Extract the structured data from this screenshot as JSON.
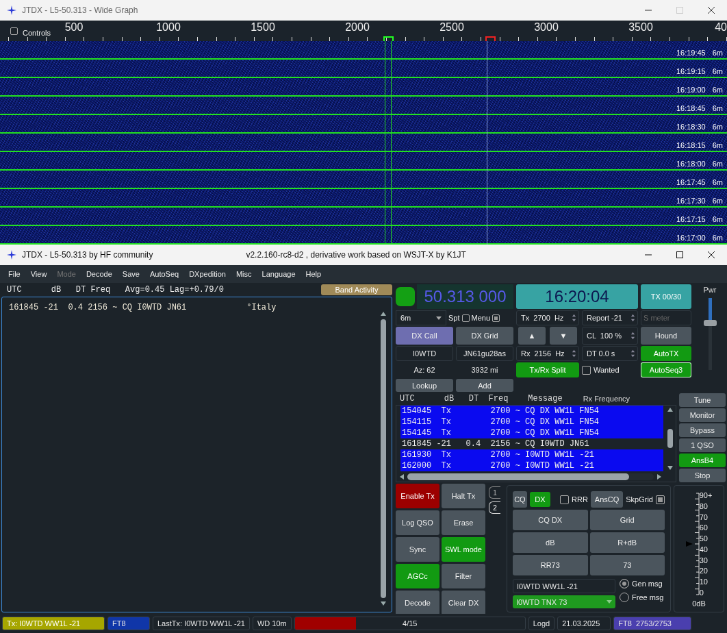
{
  "wide_graph": {
    "title": "JTDX - L5-50.313 - Wide Graph",
    "controls": {
      "label": "Controls",
      "checked": false
    },
    "freq_axis": [
      "500",
      "1000",
      "1500",
      "2000",
      "2500",
      "3000",
      "3500",
      "40"
    ],
    "rows": [
      {
        "time": "16:19:45",
        "band": "6m"
      },
      {
        "time": "16:19:15",
        "band": "6m"
      },
      {
        "time": "16:19:00",
        "band": "6m"
      },
      {
        "time": "16:18:45",
        "band": "6m"
      },
      {
        "time": "16:18:30",
        "band": "6m"
      },
      {
        "time": "16:18:15",
        "band": "6m"
      },
      {
        "time": "16:18:00",
        "band": "6m"
      },
      {
        "time": "16:17:45",
        "band": "6m"
      },
      {
        "time": "16:17:30",
        "band": "6m"
      },
      {
        "time": "16:17:15",
        "band": "6m"
      },
      {
        "time": "16:17:00",
        "band": "6m"
      }
    ]
  },
  "main_window": {
    "title": "JTDX - L5-50.313  by HF community",
    "subtitle": "v2.2.160-rc8-d2 , derivative work based on WSJT-X by K1JT"
  },
  "menu": [
    {
      "label": "File",
      "disabled": false
    },
    {
      "label": "View",
      "disabled": false
    },
    {
      "label": "Mode",
      "disabled": true
    },
    {
      "label": "Decode",
      "disabled": false
    },
    {
      "label": "Save",
      "disabled": false
    },
    {
      "label": "AutoSeq",
      "disabled": false
    },
    {
      "label": "DXpedition",
      "disabled": false
    },
    {
      "label": "Misc",
      "disabled": false
    },
    {
      "label": "Language",
      "disabled": false
    },
    {
      "label": "Help",
      "disabled": false
    }
  ],
  "band_activity": {
    "header": "UTC      dB   DT Freq   Avg=0.45 Lag=+0.79/0",
    "button": "Band Activity",
    "lines": [
      {
        "text": "161845 -21  0.4 2156 ~ CQ I0WTD JN61",
        "country": "°Italy"
      }
    ]
  },
  "controls": {
    "status_led": {
      "on": true
    },
    "dial_frequency": "50.313 000",
    "clock": "16:20:04",
    "tx_counter": "TX 00/30",
    "power": {
      "label": "Pwr",
      "level": 0.65
    },
    "band": "6m",
    "spot": {
      "label": "Spt",
      "checked": false
    },
    "menu_toggle": {
      "label": "Menu",
      "checked": true
    },
    "tx_freq": "Tx  2700  Hz",
    "report": "Report -21",
    "s_meter": {
      "placeholder": "S meter"
    },
    "dx_call_button": "DX Call",
    "dx_grid_button": "DX Grid",
    "up": "▲",
    "down": "▼",
    "cl": "CL  100 %",
    "hound": {
      "label": "Hound",
      "on": false
    },
    "dx_call": "I0WTD",
    "dx_grid": "JN61gu28as",
    "rx_freq": "Rx  2156  Hz",
    "dt": "DT 0.0 s",
    "auto_tx": {
      "label": "AutoTX",
      "on": true
    },
    "azimuth": "Az: 62",
    "distance": "3932 mi",
    "split": {
      "label": "Tx/Rx Split",
      "on": true
    },
    "wanted": {
      "label": "Wanted",
      "checked": false
    },
    "autoseq": {
      "label": "AutoSeq3",
      "on": true
    },
    "lookup": "Lookup",
    "add": "Add"
  },
  "rx_frequency": {
    "header": "UTC      dB   DT  Freq    Message",
    "title": "Rx Frequency",
    "rows": [
      {
        "text": "154045  Tx        2700 ~ CQ DX WW1L FN54",
        "highlighted": true
      },
      {
        "text": "154115  Tx        2700 ~ CQ DX WW1L FN54",
        "highlighted": true
      },
      {
        "text": "154145  Tx        2700 ~ CQ DX WW1L FN54",
        "highlighted": true
      },
      {
        "text": "161845 -21   0.4  2156 ~ CQ I0WTD JN61",
        "highlighted": false
      },
      {
        "text": "161930  Tx        2700 ~ I0WTD WW1L -21",
        "highlighted": true
      },
      {
        "text": "162000  Tx        2700 ~ I0WTD WW1L -21",
        "highlighted": true
      }
    ]
  },
  "side_buttons": [
    {
      "label": "Tune",
      "on": false
    },
    {
      "label": "Monitor",
      "on": false
    },
    {
      "label": "Bypass",
      "on": false
    },
    {
      "label": "1 QSO",
      "on": false
    },
    {
      "label": "AnsB4",
      "on": true
    },
    {
      "label": "Stop",
      "on": false
    }
  ],
  "tx_buttons": [
    {
      "label": "Enable Tx",
      "on": true,
      "kind": "alert"
    },
    {
      "label": "Halt Tx",
      "on": false,
      "kind": "toggle"
    },
    {
      "label": "Log QSO",
      "on": false,
      "kind": "toggle"
    },
    {
      "label": "Erase",
      "on": false,
      "kind": "toggle"
    },
    {
      "label": "Sync",
      "on": false,
      "kind": "toggle"
    },
    {
      "label": "SWL mode",
      "on": true,
      "kind": "toggle"
    },
    {
      "label": "AGCc",
      "on": true,
      "kind": "toggle"
    },
    {
      "label": "Filter",
      "on": false,
      "kind": "toggle"
    },
    {
      "label": "Decode",
      "on": false,
      "kind": "toggle"
    },
    {
      "label": "Clear DX",
      "on": false,
      "kind": "toggle"
    }
  ],
  "tabs": [
    {
      "label": "1",
      "selected": false
    },
    {
      "label": "2",
      "selected": true
    }
  ],
  "messages": {
    "cq": {
      "label": "CQ",
      "on": false
    },
    "dx": {
      "label": "DX",
      "on": true
    },
    "rrr": {
      "label": "RRR",
      "checked": false
    },
    "ans_cq": "AnsCQ",
    "skip_grid": {
      "label": "SkpGrid",
      "checked": true
    },
    "buttons": [
      "CQ DX",
      "Grid",
      "dB",
      "R+dB",
      "RR73",
      "73"
    ],
    "gen_message": "I0WTD WW1L -21",
    "free_message": "I0WTD TNX 73",
    "modes": [
      {
        "label": "Gen msg",
        "selected": true
      },
      {
        "label": "Free msg",
        "selected": false
      }
    ]
  },
  "signal_meter": {
    "scale": [
      "90+",
      "80",
      "70",
      "60",
      "50",
      "40",
      "30",
      "20",
      "10",
      "0"
    ],
    "label": "0dB",
    "level": 0.5
  },
  "status_bar": [
    {
      "text": "Tx: I0WTD WW1L -21",
      "kind": "tx"
    },
    {
      "text": "FT8",
      "kind": "mode"
    },
    {
      "text": "LastTx: I0WTD WW1L -21",
      "kind": "plain"
    },
    {
      "text": "WD 10m",
      "kind": "plain"
    },
    {
      "text": "4/15",
      "kind": "progress",
      "level": 0.267
    },
    {
      "text": "Logd",
      "kind": "plain"
    },
    {
      "text": "21.03.2025",
      "kind": "plain"
    },
    {
      "text": "FT8  2753/2753",
      "kind": "decodes"
    }
  ]
}
